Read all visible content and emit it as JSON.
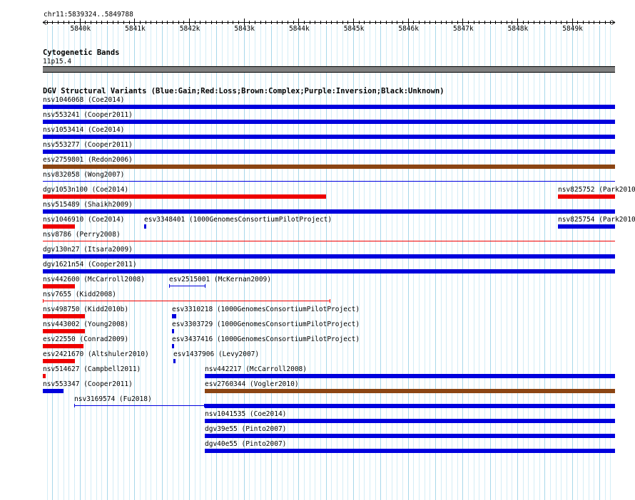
{
  "ruler": {
    "coordinate": "chr11:5839324..5849788",
    "start": 5839324,
    "end": 5849788,
    "ticks": [
      "5840k",
      "5841k",
      "5842k",
      "5843k",
      "5844k",
      "5845k",
      "5846k",
      "5847k",
      "5848k",
      "5849k"
    ]
  },
  "cytoband": {
    "title": "Cytogenetic Bands",
    "band": "11p15.4",
    "color": "#808080"
  },
  "dgv": {
    "title": "DGV Structural Variants (Blue:Gain;Red:Loss;Brown:Complex;Purple:Inversion;Black:Unknown)",
    "colors": {
      "gain": "#0000dd",
      "loss": "#ee0000",
      "complex": "#8b4513"
    },
    "features": [
      {
        "label": "nsv1046068 (Coe2014)",
        "start": 5839324,
        "end": 5849788,
        "type": "gain",
        "style": "thick",
        "row": 0
      },
      {
        "label": "nsv553241 (Cooper2011)",
        "start": 5839324,
        "end": 5849788,
        "type": "gain",
        "style": "thick",
        "row": 1
      },
      {
        "label": "nsv1053414 (Coe2014)",
        "start": 5839324,
        "end": 5849788,
        "type": "gain",
        "style": "thick",
        "row": 2
      },
      {
        "label": "nsv553277 (Cooper2011)",
        "start": 5839324,
        "end": 5849788,
        "type": "gain",
        "style": "thick",
        "row": 3
      },
      {
        "label": "esv2759801 (Redon2006)",
        "start": 5839324,
        "end": 5849788,
        "type": "complex",
        "style": "thick",
        "row": 4
      },
      {
        "label": "nsv832058 (Wong2007)",
        "start": 5839324,
        "end": 5849788,
        "type": "gain",
        "style": "thin",
        "row": 5
      },
      {
        "label": "dgv1053n100 (Coe2014)",
        "start": 5839324,
        "end": 5844510,
        "type": "loss",
        "style": "thick",
        "row": 6
      },
      {
        "label": "nsv825752 (Park2010)",
        "start": 5848740,
        "end": 5849788,
        "type": "loss",
        "style": "thick",
        "row": 6
      },
      {
        "label": "nsv515489 (Shaikh2009)",
        "start": 5839324,
        "end": 5849788,
        "type": "gain",
        "style": "thick",
        "row": 7
      },
      {
        "label": "nsv1046910 (Coe2014)",
        "start": 5839324,
        "end": 5839910,
        "type": "loss",
        "style": "thick",
        "row": 8
      },
      {
        "label": "esv3348401 (1000GenomesConsortiumPilotProject)",
        "start": 5841180,
        "end": 5841220,
        "type": "gain",
        "style": "thick",
        "row": 8
      },
      {
        "label": "nsv825754 (Park2010)",
        "start": 5848740,
        "end": 5849788,
        "type": "gain",
        "style": "thick",
        "row": 8
      },
      {
        "label": "nsv8786 (Perry2008)",
        "start": 5839324,
        "end": 5849788,
        "type": "loss",
        "style": "thin",
        "row": 9
      },
      {
        "label": "dgv130n27 (Itsara2009)",
        "start": 5839324,
        "end": 5849788,
        "type": "gain",
        "style": "thick",
        "row": 10
      },
      {
        "label": "dgv1621n54 (Cooper2011)",
        "start": 5839324,
        "end": 5849788,
        "type": "gain",
        "style": "thick",
        "row": 11
      },
      {
        "label": "nsv442600 (McCarroll2008)",
        "start": 5839324,
        "end": 5839910,
        "type": "loss",
        "style": "thick",
        "row": 12
      },
      {
        "label": "esv2515001 (McKernan2009)",
        "start": 5841635,
        "end": 5842300,
        "type": "gain",
        "style": "capped",
        "row": 12
      },
      {
        "label": "nsv7655 (Kidd2008)",
        "start": 5839324,
        "end": 5844580,
        "type": "loss",
        "style": "capped",
        "row": 13
      },
      {
        "label": "nsv498750 (Kidd2010b)",
        "start": 5839324,
        "end": 5840090,
        "type": "loss",
        "style": "thick",
        "row": 14
      },
      {
        "label": "esv3310218 (1000GenomesConsortiumPilotProject)",
        "start": 5841680,
        "end": 5841770,
        "type": "gain",
        "style": "thick",
        "row": 14
      },
      {
        "label": "nsv443002 (Young2008)",
        "start": 5839324,
        "end": 5840090,
        "type": "loss",
        "style": "thick",
        "row": 15
      },
      {
        "label": "esv3303729 (1000GenomesConsortiumPilotProject)",
        "start": 5841680,
        "end": 5841725,
        "type": "gain",
        "style": "thick",
        "row": 15
      },
      {
        "label": "esv22550 (Conrad2009)",
        "start": 5839324,
        "end": 5840070,
        "type": "loss",
        "style": "thick",
        "row": 16
      },
      {
        "label": "esv3437416 (1000GenomesConsortiumPilotProject)",
        "start": 5841680,
        "end": 5841725,
        "type": "gain",
        "style": "thick",
        "row": 16
      },
      {
        "label": "esv2421670 (Altshuler2010)",
        "start": 5839324,
        "end": 5839910,
        "type": "loss",
        "style": "thick",
        "row": 17
      },
      {
        "label": "esv1437906 (Levy2007)",
        "start": 5841715,
        "end": 5841735,
        "type": "gain",
        "style": "thick",
        "row": 17
      },
      {
        "label": "nsv514627 (Campbell2011)",
        "start": 5839324,
        "end": 5839370,
        "type": "loss",
        "style": "thick",
        "row": 18
      },
      {
        "label": "nsv442217 (McCarroll2008)",
        "start": 5842290,
        "end": 5849788,
        "type": "gain",
        "style": "thick",
        "row": 18
      },
      {
        "label": "nsv553347 (Cooper2011)",
        "start": 5839324,
        "end": 5839700,
        "type": "gain",
        "style": "thick",
        "row": 19
      },
      {
        "label": "esv2760344 (Vogler2010)",
        "start": 5842290,
        "end": 5849788,
        "type": "complex",
        "style": "thick",
        "row": 19
      },
      {
        "label": "nsv3169574 (Fu2018)",
        "start": 5839900,
        "end": 5842290,
        "type": "gain",
        "style": "capped",
        "row": 20
      },
      {
        "label": "",
        "start": 5842290,
        "end": 5849788,
        "type": "gain",
        "style": "thick",
        "row": 20
      },
      {
        "label": "nsv1041535 (Coe2014)",
        "start": 5842290,
        "end": 5849788,
        "type": "gain",
        "style": "thick",
        "row": 21
      },
      {
        "label": "dgv39e55 (Pinto2007)",
        "start": 5842290,
        "end": 5849788,
        "type": "gain",
        "style": "thick",
        "row": 22
      },
      {
        "label": "dgv40e55 (Pinto2007)",
        "start": 5842290,
        "end": 5849788,
        "type": "gain",
        "style": "thick",
        "row": 23
      }
    ]
  },
  "grid": {
    "color": "#a8d8ea",
    "minor_color": "#d4edf6"
  }
}
